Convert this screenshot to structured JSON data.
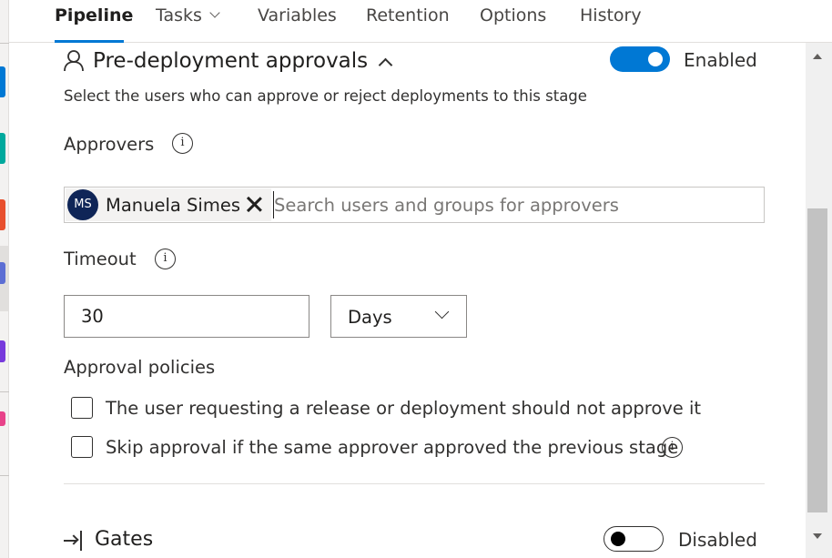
{
  "tabs": [
    {
      "label": "Pipeline"
    },
    {
      "label": "Tasks"
    },
    {
      "label": "Variables"
    },
    {
      "label": "Retention"
    },
    {
      "label": "Options"
    },
    {
      "label": "History"
    }
  ],
  "left_nav_colors": [
    "#0078d4",
    "#00a99d",
    "#e8502e",
    "#5c6ed4",
    "#773adc",
    "#e8438a"
  ],
  "pre_deployment": {
    "title": "Pre-deployment approvals",
    "toggle_label": "Enabled",
    "enabled": true,
    "description": "Select the users who can approve or reject deployments to this stage",
    "approvers_label": "Approvers",
    "approvers": [
      {
        "initials": "MS",
        "name": "Manuela Simes"
      }
    ],
    "approvers_placeholder": "Search users and groups for approvers",
    "timeout_label": "Timeout",
    "timeout_value": "30",
    "timeout_unit": "Days",
    "policies_label": "Approval policies",
    "policies": [
      {
        "label": "The user requesting a release or deployment should not approve it",
        "checked": false
      },
      {
        "label": "Skip approval if the same approver approved the previous stage",
        "checked": false
      }
    ]
  },
  "gates": {
    "title": "Gates",
    "toggle_label": "Disabled",
    "enabled": false
  },
  "icons": {
    "section": "person-icon",
    "collapse": "chevron-up-icon",
    "info": "info-icon",
    "remove": "close-icon",
    "dropdown": "chevron-down-icon",
    "gates": "arrow-into-bar-icon"
  }
}
